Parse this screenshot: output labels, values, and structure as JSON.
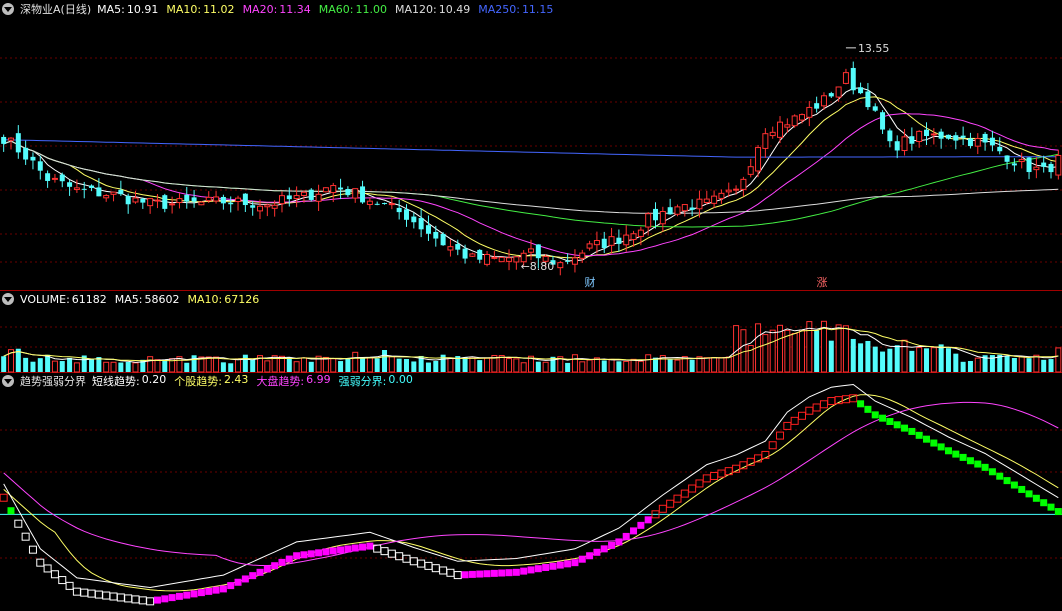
{
  "price_header": {
    "title": "深物业A(日线)",
    "items": [
      {
        "label": "MA5:",
        "value": "10.91",
        "color": "#ffffff"
      },
      {
        "label": "MA10:",
        "value": "11.02",
        "color": "#ffff66"
      },
      {
        "label": "MA20:",
        "value": "11.34",
        "color": "#ff44ff"
      },
      {
        "label": "MA60:",
        "value": "11.00",
        "color": "#44ee44"
      },
      {
        "label": "MA120:",
        "value": "10.49",
        "color": "#dddddd"
      },
      {
        "label": "MA250:",
        "value": "11.15",
        "color": "#4466ff"
      }
    ]
  },
  "volume_header": {
    "items": [
      {
        "label": "VOLUME:",
        "value": "61182",
        "color": "#ffffff"
      },
      {
        "label": "MA5:",
        "value": "58602",
        "color": "#ffffff"
      },
      {
        "label": "MA10:",
        "value": "67126",
        "color": "#ffff66"
      }
    ]
  },
  "trend_header": {
    "title": "趋势强弱分界",
    "items": [
      {
        "label": "短线趋势:",
        "value": "0.20",
        "color": "#ffffff"
      },
      {
        "label": "个股趋势:",
        "value": "2.43",
        "color": "#ffff66"
      },
      {
        "label": "大盘趋势:",
        "value": "6.99",
        "color": "#ff44ff"
      },
      {
        "label": "强弱分界:",
        "value": "0.00",
        "color": "#44ffff"
      }
    ]
  },
  "annotations": {
    "high_label": "13.55",
    "low_label": "8.80",
    "marker_cai": "财",
    "marker_zhang": "涨"
  },
  "colors": {
    "up": "#ff3232",
    "down": "#54fcfc",
    "background": "#000000",
    "grid": "#6a0000",
    "divider": "#a00000",
    "ma5": "#ffffff",
    "ma10": "#ffff66",
    "ma20": "#ff44ff",
    "ma60": "#44ee44",
    "ma120": "#dddddd",
    "ma250": "#4466ff",
    "trend_white": "#ffffff",
    "trend_magenta": "#ff00ff",
    "trend_green": "#00ff00",
    "trend_red": "#ff2020",
    "boundary": "#44ffff"
  },
  "chart_data": [
    {
      "type": "candlestick",
      "title": "深物业A(日线)",
      "ylim": [
        8.3,
        14.2
      ],
      "series": [
        {
          "name": "MA5",
          "values": [
            10.91
          ]
        },
        {
          "name": "MA10",
          "values": [
            11.02
          ]
        },
        {
          "name": "MA20",
          "values": [
            11.34
          ]
        },
        {
          "name": "MA60",
          "values": [
            11.0
          ]
        },
        {
          "name": "MA120",
          "values": [
            10.49
          ]
        },
        {
          "name": "MA250",
          "values": [
            11.15
          ]
        }
      ],
      "annotations": [
        {
          "text": "13.55",
          "value": 13.55
        },
        {
          "text": "8.80",
          "value": 8.8
        }
      ],
      "anchors": [
        [
          0,
          11.6
        ],
        [
          3,
          11.2
        ],
        [
          6,
          10.7
        ],
        [
          10,
          10.45
        ],
        [
          15,
          10.35
        ],
        [
          20,
          10.15
        ],
        [
          25,
          10.15
        ],
        [
          30,
          10.2
        ],
        [
          36,
          10.15
        ],
        [
          41,
          10.3
        ],
        [
          45,
          10.55
        ],
        [
          50,
          10.25
        ],
        [
          55,
          9.9
        ],
        [
          60,
          9.3
        ],
        [
          64,
          8.95
        ],
        [
          68,
          8.95
        ],
        [
          72,
          9.05
        ],
        [
          76,
          8.85
        ],
        [
          80,
          9.2
        ],
        [
          84,
          9.4
        ],
        [
          88,
          9.8
        ],
        [
          92,
          10.1
        ],
        [
          96,
          10.15
        ],
        [
          100,
          10.4
        ],
        [
          104,
          11.8
        ],
        [
          108,
          12.0
        ],
        [
          112,
          12.4
        ],
        [
          115,
          12.9
        ],
        [
          118,
          12.4
        ],
        [
          121,
          11.4
        ],
        [
          125,
          11.6
        ],
        [
          129,
          11.65
        ],
        [
          133,
          11.5
        ],
        [
          136,
          11.3
        ],
        [
          139,
          11.0
        ],
        [
          142,
          10.85
        ],
        [
          144,
          11.1
        ]
      ]
    },
    {
      "type": "bar",
      "title": "VOLUME",
      "series": [
        {
          "name": "VOLUME",
          "values": [
            61182
          ]
        },
        {
          "name": "MA5",
          "values": [
            58602
          ]
        },
        {
          "name": "MA10",
          "values": [
            67126
          ]
        }
      ]
    },
    {
      "type": "line",
      "title": "趋势强弱分界",
      "ylim": [
        -7,
        9
      ],
      "series": [
        {
          "name": "短线趋势",
          "values": [
            0.2
          ]
        },
        {
          "name": "个股趋势",
          "values": [
            2.43
          ]
        },
        {
          "name": "大盘趋势",
          "values": [
            6.99
          ]
        },
        {
          "name": "强弱分界",
          "values": [
            0.0
          ]
        }
      ],
      "anchors": [
        [
          0,
          1.2
        ],
        [
          5,
          -3.5
        ],
        [
          10,
          -5.6
        ],
        [
          20,
          -6.3
        ],
        [
          30,
          -5.4
        ],
        [
          40,
          -3.0
        ],
        [
          50,
          -2.3
        ],
        [
          56,
          -3.4
        ],
        [
          62,
          -4.4
        ],
        [
          70,
          -4.2
        ],
        [
          78,
          -3.5
        ],
        [
          84,
          -2.0
        ],
        [
          90,
          0.4
        ],
        [
          96,
          2.6
        ],
        [
          100,
          3.3
        ],
        [
          104,
          4.3
        ],
        [
          107,
          6.4
        ],
        [
          110,
          7.5
        ],
        [
          113,
          8.2
        ],
        [
          116,
          8.4
        ],
        [
          119,
          7.2
        ],
        [
          124,
          6.0
        ],
        [
          129,
          4.6
        ],
        [
          134,
          3.4
        ],
        [
          139,
          1.8
        ],
        [
          144,
          0.2
        ]
      ]
    }
  ]
}
